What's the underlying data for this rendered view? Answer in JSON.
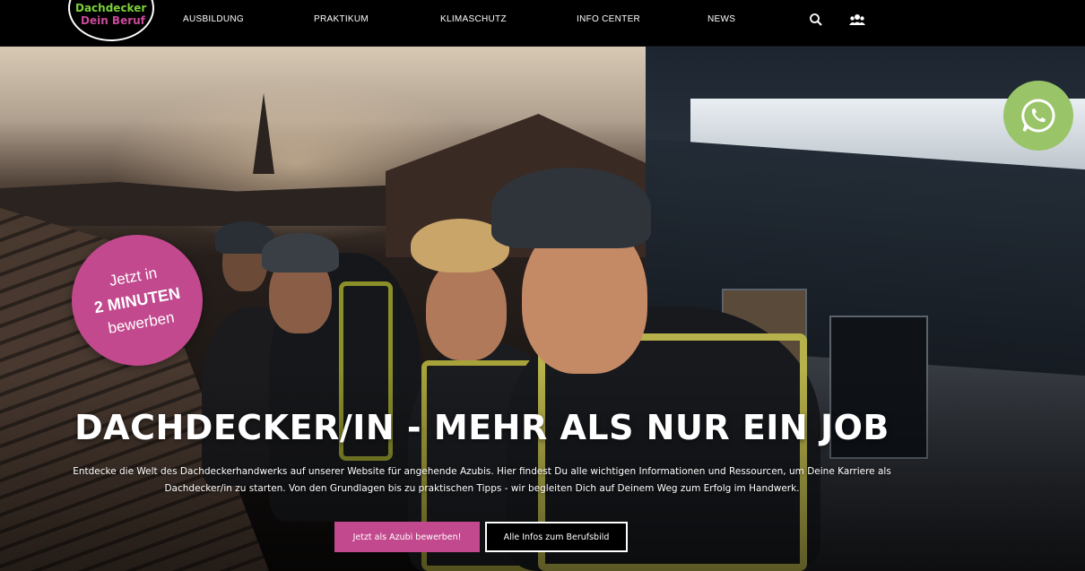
{
  "logo": {
    "line1": "Dachdecker",
    "line2": "Dein Beruf"
  },
  "nav": {
    "items": [
      {
        "label": "AUSBILDUNG"
      },
      {
        "label": "PRAKTIKUM"
      },
      {
        "label": "KLIMASCHUTZ"
      },
      {
        "label": "INFO CENTER"
      },
      {
        "label": "NEWS"
      }
    ],
    "icons": [
      "search-icon",
      "community-icon"
    ]
  },
  "badge": {
    "line1": "Jetzt in",
    "line2": "2 MINUTEN",
    "line3": "bewerben"
  },
  "whatsapp": {
    "icon": "whatsapp-icon",
    "color": "#9ac468"
  },
  "hero": {
    "headline": "DACHDECKER/IN - MEHR ALS NUR EIN JOB",
    "lead_line1": "Entdecke die Welt des Dachdeckerhandwerks auf unserer Website für angehende Azubis. Hier findest Du alle wichtigen Informationen und Ressourcen, um Deine Karriere als",
    "lead_line2": "Dachdecker/in zu starten. Von den Grundlagen bis zu praktischen Tipps - wir begleiten Dich auf Deinem Weg zum Erfolg im Handwerk.",
    "cta_primary": "Jetzt als Azubi bewerben!",
    "cta_secondary": "Alle Infos zum Berufsbild"
  },
  "colors": {
    "brand_pink": "#c2498e",
    "brand_green": "#7ccf3a",
    "nav_bg": "#000000"
  }
}
